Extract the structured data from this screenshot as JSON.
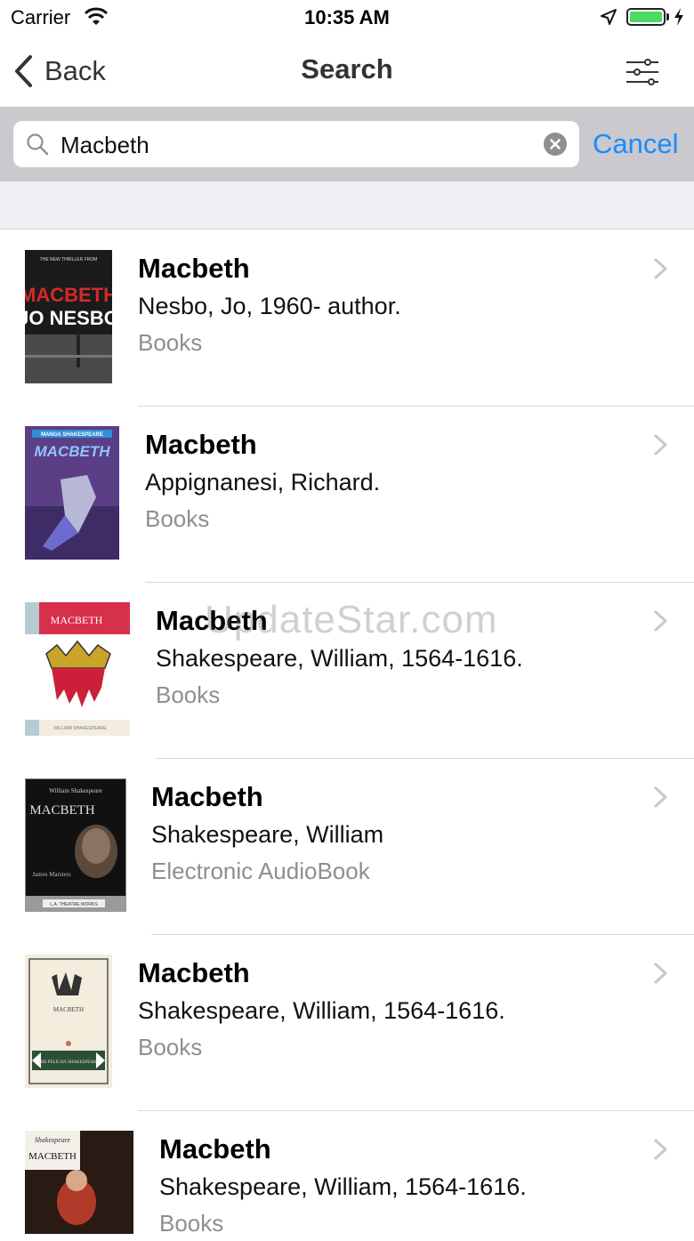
{
  "status_bar": {
    "carrier": "Carrier",
    "time": "10:35 AM"
  },
  "nav": {
    "back_label": "Back",
    "title": "Search"
  },
  "search": {
    "query": "Macbeth",
    "cancel_label": "Cancel"
  },
  "results": [
    {
      "title": "Macbeth",
      "author": "Nesbo, Jo, 1960- author.",
      "format": "Books",
      "cover_lines": [
        "THE NEW THRILLER FROM",
        "MACBETH",
        "JO NESBO"
      ]
    },
    {
      "title": "Macbeth",
      "author": "Appignanesi, Richard.",
      "format": "Books",
      "cover_lines": [
        "MANGA SHAKESPEARE",
        "MACBETH"
      ]
    },
    {
      "title": "Macbeth",
      "author": "Shakespeare, William, 1564-1616.",
      "format": "Books",
      "cover_lines": [
        "MACBETH",
        "WILLIAM SHAKESPEARE"
      ]
    },
    {
      "title": "Macbeth",
      "author": "Shakespeare, William",
      "format": "Electronic AudioBook",
      "cover_lines": [
        "William Shakespeare",
        "MACBETH",
        "James Marsters",
        "L.A. THEATRE WORKS"
      ]
    },
    {
      "title": "Macbeth",
      "author": "Shakespeare, William, 1564-1616.",
      "format": "Books",
      "cover_lines": [
        "MACBETH",
        "THE PELICAN SHAKESPEARE"
      ]
    },
    {
      "title": "Macbeth",
      "author": "Shakespeare, William, 1564-1616.",
      "format": "Books",
      "cover_lines": [
        "Shakespeare",
        "MACBETH"
      ]
    }
  ],
  "watermark": "UpdateStar.com",
  "icons": {
    "back": "chevron-left-icon",
    "filter": "sliders-icon",
    "search": "magnifier-icon",
    "clear": "clear-circle-icon",
    "row": "chevron-right-icon"
  },
  "colors": {
    "accent": "#1a8cff",
    "search_bg": "#c9c9ce",
    "secondary_text": "#8e8e93",
    "battery": "#4cd964"
  }
}
